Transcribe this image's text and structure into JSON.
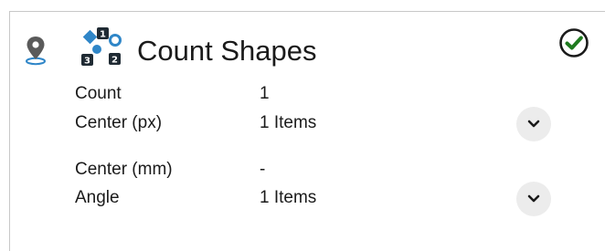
{
  "tool": {
    "title": "Count Shapes",
    "location_icon": "map-pin-icon",
    "tool_icon": "count-shapes-icon",
    "status_icon": "check-circle-icon",
    "status_color": "#1f7a1f"
  },
  "properties": [
    {
      "label": "Count",
      "value": "1"
    },
    {
      "label": "Center (px)",
      "value": "1 Items",
      "expand_icon": "chevron-down-icon"
    },
    {
      "label": "Center (mm)",
      "value": "-"
    },
    {
      "label": "Angle",
      "value": "1 Items",
      "expand_icon": "chevron-down-icon"
    }
  ],
  "colors": {
    "icon_blue": "#2f86c8",
    "icon_dark": "#1f2a33",
    "pin_gray": "#5a5a5a"
  }
}
